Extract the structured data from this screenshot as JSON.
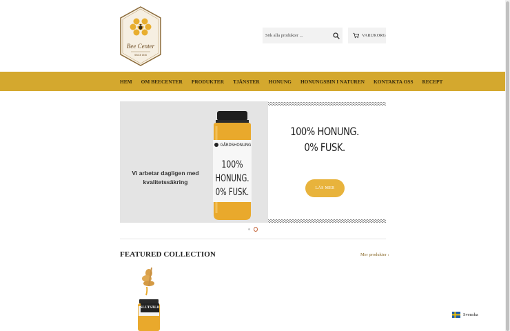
{
  "brand": {
    "logo_text": "Bee Center",
    "logo_since": "SINCE 1945"
  },
  "header": {
    "search_placeholder": "Sök alla produkter ...",
    "cart_label": "VARUKORG"
  },
  "nav": {
    "items": [
      "HEM",
      "OM BEECENTER",
      "PRODUKTER",
      "TJÄNSTER",
      "HONUNG",
      "HONUNGSBIN I NATUREN",
      "KONTAKTA OSS",
      "RECEPT"
    ]
  },
  "slider": {
    "left_caption": "Vi arbetar dagligen med kvalitetssäkring",
    "jar_brand": "GÅRDSHONUNG",
    "jar_text": [
      "100%",
      "HONUNG.",
      "0% FUSK."
    ],
    "headline_line1": "100% HONUNG.",
    "headline_line2": "0% FUSK.",
    "cta_label": "LÄS MER",
    "slide_count": 2,
    "active_slide": 2
  },
  "featured": {
    "title": "FEATURED COLLECTION",
    "more_link": "Mer produkter ›",
    "products": [
      {
        "badge": "SLUTSÅLD"
      }
    ]
  },
  "language": {
    "label": "Svenska",
    "flag": "sweden-flag-icon"
  },
  "colors": {
    "nav_bg": "#d4a82e",
    "cta_bg": "#e8b33c",
    "honey": "#e9a92c"
  }
}
